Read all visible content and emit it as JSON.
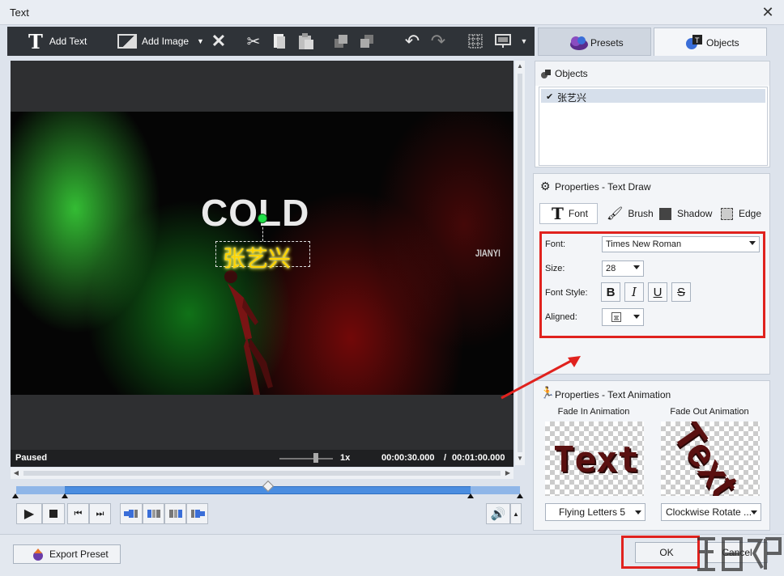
{
  "window": {
    "title": "Text"
  },
  "toolbar": {
    "add_text_label": "Add Text",
    "add_image_label": "Add Image"
  },
  "tabs": {
    "presets_label": "Presets",
    "objects_label": "Objects"
  },
  "video": {
    "title_text": "COLD",
    "overlay_text": "张艺兴",
    "corner_text": "JIANYI"
  },
  "status": {
    "state": "Paused",
    "speed": "1x",
    "current_time": "00:00:30.000",
    "separator": "/",
    "total_time": "00:01:00.000"
  },
  "objects_panel": {
    "title": "Objects",
    "items": [
      {
        "name": "张艺兴",
        "checked": true
      }
    ]
  },
  "properties": {
    "title": "Properties - Text Draw",
    "tabs": {
      "font": "Font",
      "brush": "Brush",
      "shadow": "Shadow",
      "edge": "Edge"
    },
    "font_label": "Font:",
    "font_value": "Times New Roman",
    "size_label": "Size:",
    "size_value": "28",
    "style_label": "Font Style:",
    "bold": "B",
    "italic": "I",
    "underline": "U",
    "strike": "S",
    "aligned_label": "Aligned:"
  },
  "animation": {
    "title": "Properties - Text Animation",
    "fade_in_label": "Fade In Animation",
    "fade_out_label": "Fade Out Animation",
    "preview_in_text": "Text",
    "preview_out_text": "Text",
    "fade_in_value": "Flying Letters 5",
    "fade_out_value": "Clockwise Rotate ..."
  },
  "footer": {
    "export_label": "Export Preset",
    "ok_label": "OK",
    "cancel_label": "Cancel"
  }
}
